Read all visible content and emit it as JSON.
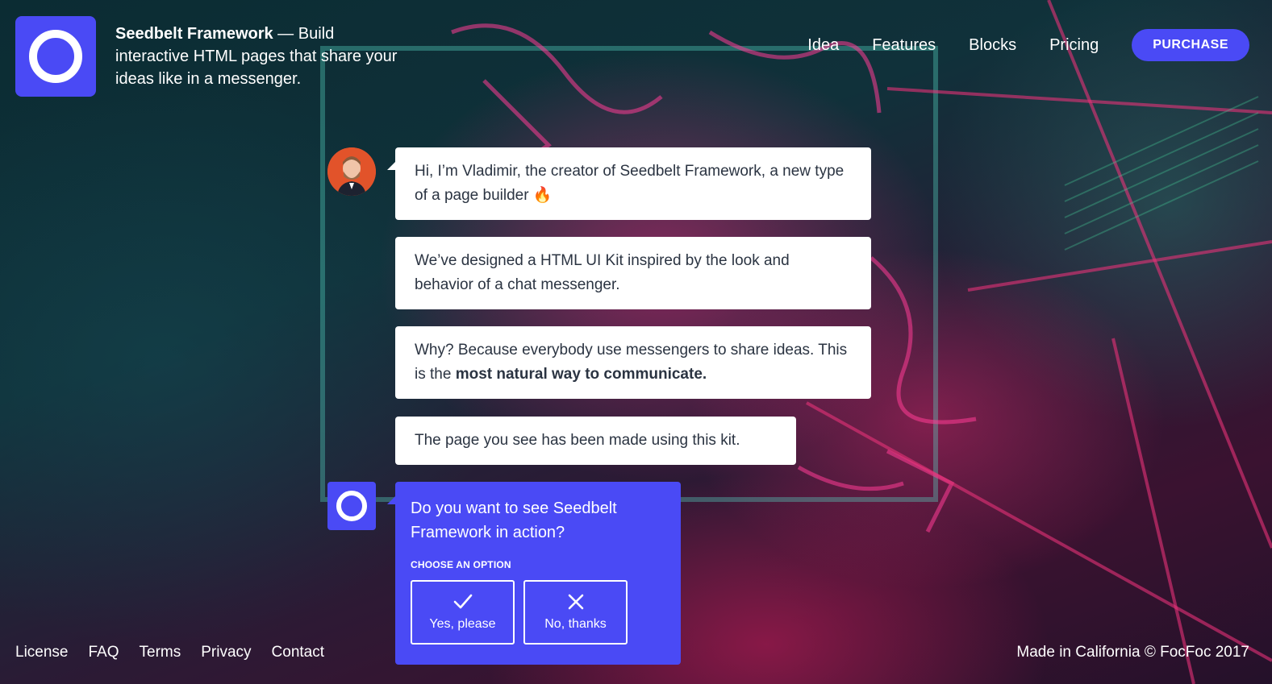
{
  "brand": {
    "name": "Seedbelt Framework",
    "tagline": " — Build interactive HTML pages that share your ideas like in a messenger."
  },
  "nav": {
    "items": [
      "Idea",
      "Features",
      "Blocks",
      "Pricing"
    ],
    "purchase_label": "PURCHASE"
  },
  "chat": {
    "messages": [
      "Hi, I’m Vladimir, the creator of Seedbelt Framework, a new type of a page builder 🔥",
      "We’ve designed a HTML UI Kit inspired by the look and behavior of a chat messenger.",
      "Why? Because everybody use messengers to share ideas. This is the ",
      "The page you see has been made using this kit."
    ],
    "emphasis": "most natural way to communicate.",
    "question": "Do you want to see Seedbelt Framework in action?",
    "choose_label": "CHOOSE AN OPTION",
    "options": [
      {
        "label": "Yes, please",
        "icon": "check-icon"
      },
      {
        "label": "No, thanks",
        "icon": "close-icon"
      }
    ]
  },
  "footer": {
    "links": [
      "License",
      "FAQ",
      "Terms",
      "Privacy",
      "Contact"
    ],
    "credit": "Made in California © FocFoc 2017"
  },
  "colors": {
    "accent": "#4a4af5",
    "bubble": "#ffffff",
    "bubble_text": "#2b3442"
  }
}
